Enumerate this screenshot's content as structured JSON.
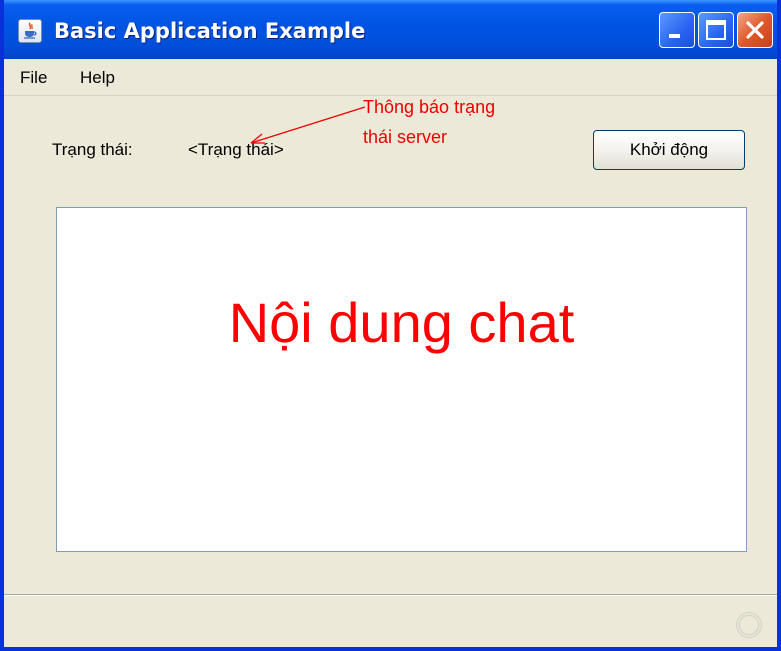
{
  "window": {
    "title": "Basic Application Example"
  },
  "menu": {
    "items": [
      {
        "label": "File"
      },
      {
        "label": "Help"
      }
    ]
  },
  "status": {
    "label": "Trạng thái:",
    "value": "<Trạng thái>"
  },
  "annotation": {
    "line1": "Thông báo trạng",
    "line2": "thái server"
  },
  "toolbar": {
    "start_label": "Khởi động"
  },
  "chat": {
    "content": "Nội dung chat"
  },
  "icons": {
    "app": "java-cup-icon",
    "minimize": "minimize-icon",
    "maximize": "maximize-icon",
    "close": "close-icon",
    "busy": "busy-indicator-icon"
  },
  "colors": {
    "titlebar": "#0054e3",
    "annotation": "#ee0000",
    "chat_text": "#ff0000",
    "window_bg": "#ece9d8"
  }
}
